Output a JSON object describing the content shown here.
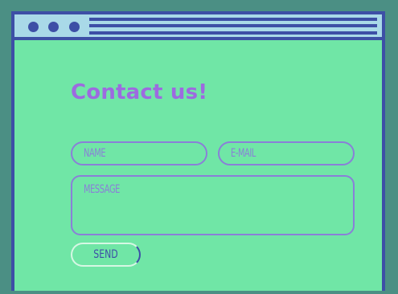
{
  "form": {
    "title": "Contact us!",
    "name_placeholder": "NAME",
    "email_placeholder": "E-MAIL",
    "message_placeholder": "MESSAGE",
    "send_label": "SEND"
  },
  "colors": {
    "background": "#4b8f84",
    "window_fill": "#70e6a6",
    "window_border": "#3d4fa6",
    "titlebar": "#a9d9e8",
    "accent": "#9d6ae0"
  }
}
